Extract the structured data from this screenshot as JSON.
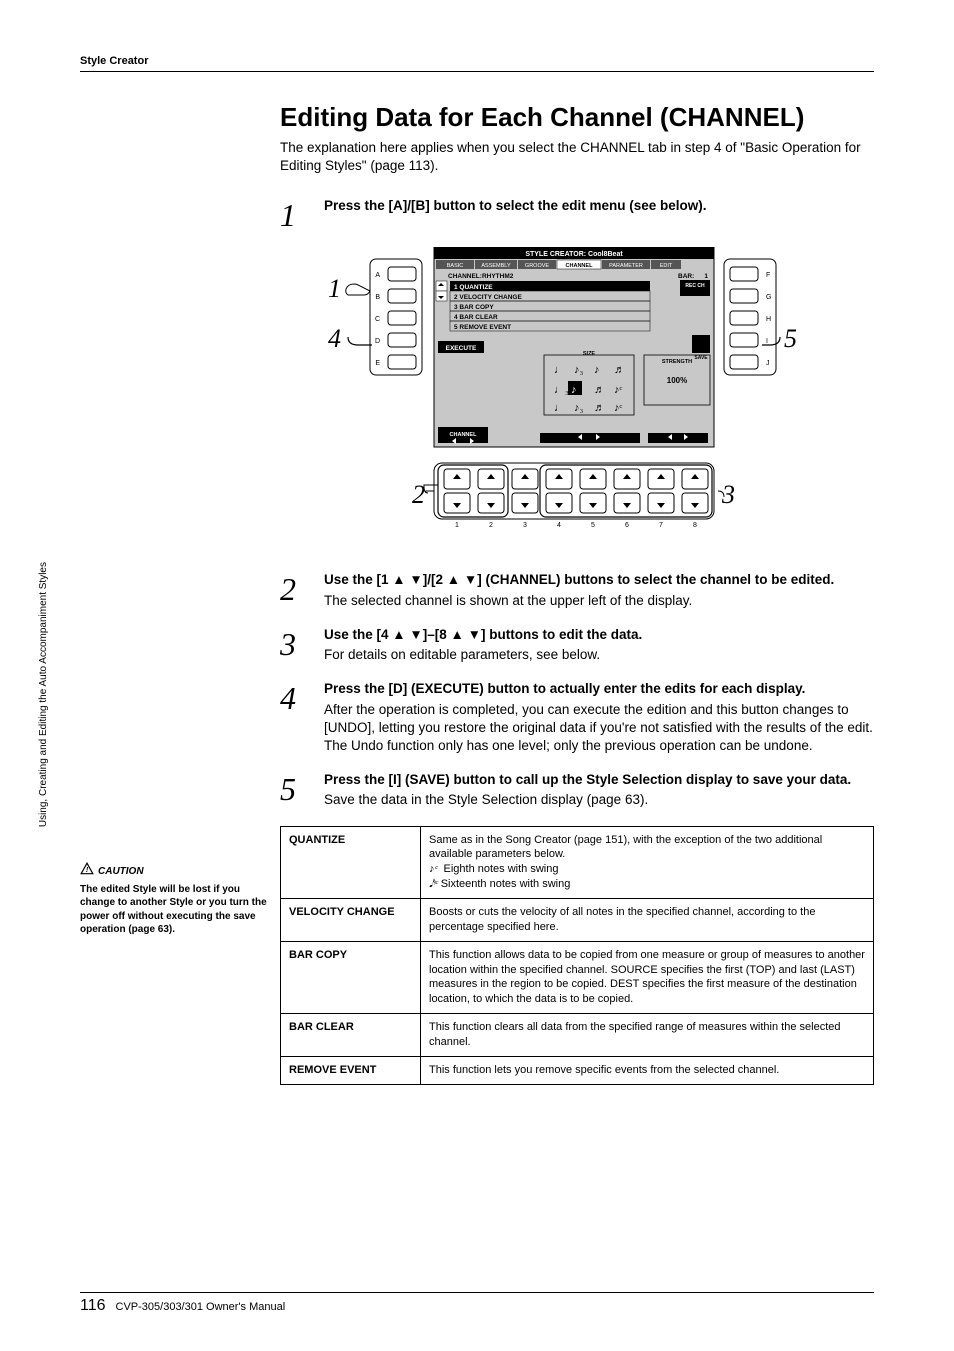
{
  "header": {
    "chapter": "Style Creator"
  },
  "sidebar_tab": "Using, Creating and Editing the Auto Accompaniment Styles",
  "caution": {
    "title": "CAUTION",
    "text": "The edited Style will be lost if you change to another Style or you turn the power off without executing the save operation (page 63)."
  },
  "title": "Editing Data for Each Channel (CHANNEL)",
  "intro": "The explanation here applies when you select the CHANNEL tab in step 4 of \"Basic Operation for Editing Styles\" (page 113).",
  "steps": [
    {
      "num": "1",
      "title": "Press the [A]/[B] button to select the edit menu (see below).",
      "body": ""
    },
    {
      "num": "2",
      "title": "Use the [1 ▲ ▼]/[2 ▲ ▼] (CHANNEL) buttons to select the channel to be edited.",
      "body": "The selected channel is shown at the upper left of the display."
    },
    {
      "num": "3",
      "title": "Use the [4 ▲ ▼]–[8 ▲ ▼] buttons to edit the data.",
      "body": "For details on editable parameters, see below."
    },
    {
      "num": "4",
      "title": "Press the [D] (EXECUTE) button to actually enter the edits for each display.",
      "body": "After the operation is completed, you can execute the edition and this button changes to [UNDO], letting you restore the original data if you're not satisfied with the results of the edit. The Undo function only has one level; only the previous operation can be undone."
    },
    {
      "num": "5",
      "title": "Press the [I] (SAVE) button to call up the Style Selection display to save your data.",
      "body": "Save the data in the Style Selection display (page 63)."
    }
  ],
  "table": [
    {
      "name": "QUANTIZE",
      "desc_line1": "Same as in the Song Creator (page 151), with the exception of the two additional available parameters below.",
      "desc_line2": "Eighth notes with swing",
      "desc_line3": "Sixteenth notes with swing"
    },
    {
      "name": "VELOCITY CHANGE",
      "desc": "Boosts or cuts the velocity of all notes in the specified channel, according to the percentage specified here."
    },
    {
      "name": "BAR COPY",
      "desc": "This function allows data to be copied from one measure or group of measures to another location within the specified channel. SOURCE specifies the first (TOP) and last (LAST) measures in the region to be copied. DEST specifies the first measure of the destination location, to which the data is to be copied."
    },
    {
      "name": "BAR CLEAR",
      "desc": "This function clears all data from the specified range of measures within the selected channel."
    },
    {
      "name": "REMOVE EVENT",
      "desc": "This function lets you remove specific events from the selected channel."
    }
  ],
  "screen": {
    "title": "STYLE CREATOR: Cool8Beat",
    "tabs": [
      "BASIC",
      "ASSEMBLY",
      "GROOVE",
      "CHANNEL",
      "PARAMETER",
      "EDIT"
    ],
    "channel_label": "CHANNEL:RHYTHM2",
    "bar_label": "BAR:",
    "bar_value": "1",
    "rec_ch": "REC CH",
    "menu": [
      "1 QUANTIZE",
      "2 VELOCITY CHANGE",
      "3 BAR COPY",
      "4 BAR CLEAR",
      "5 REMOVE EVENT"
    ],
    "execute": "EXECUTE",
    "save": "SAVE",
    "size_label": "SIZE",
    "strength_label": "STRENGTH",
    "strength_value": "100%",
    "channel_footer": "CHANNEL"
  },
  "callouts": {
    "c1": "1",
    "c2": "2",
    "c3": "3",
    "c4": "4",
    "c5": "5"
  },
  "panel_labels": {
    "A": "A",
    "B": "B",
    "C": "C",
    "D": "D",
    "E": "E",
    "F": "F",
    "G": "G",
    "H": "H",
    "I": "I",
    "J": "J"
  },
  "footer": {
    "page": "116",
    "doc": "CVP-305/303/301 Owner's Manual"
  }
}
